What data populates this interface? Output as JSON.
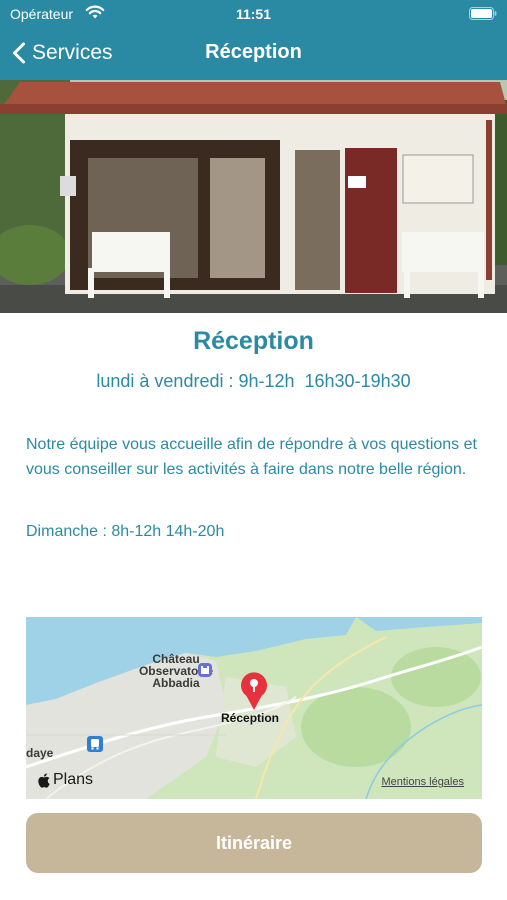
{
  "status_bar": {
    "carrier": "Opérateur",
    "time": "11:51"
  },
  "nav": {
    "back_label": "Services",
    "title": "Réception"
  },
  "content": {
    "title": "Réception",
    "hours": "lundi à vendredi : 9h-12h  16h30-19h30",
    "description": "Notre équipe vous accueille afin de répondre à vos questions et vous conseiller sur les activités à faire dans notre belle région.",
    "sunday": "Dimanche : 8h-12h 14h-20h"
  },
  "map": {
    "place_label_line1": "Château",
    "place_label_line2": "Observatoire",
    "place_label_line3": "Abbadia",
    "town_fragment": "daye",
    "pin_label": "Réception",
    "provider": "Plans",
    "legal": "Mentions légales"
  },
  "actions": {
    "itinerary_label": "Itinéraire"
  },
  "colors": {
    "header": "#2b8aa3",
    "accent_text": "#2b8aa3",
    "button": "#c7b79a",
    "pin": "#e5323d"
  },
  "icons": [
    "wifi-icon",
    "battery-icon",
    "back-chevron-icon",
    "map-pin-icon",
    "castle-icon",
    "bus-icon",
    "apple-icon"
  ]
}
